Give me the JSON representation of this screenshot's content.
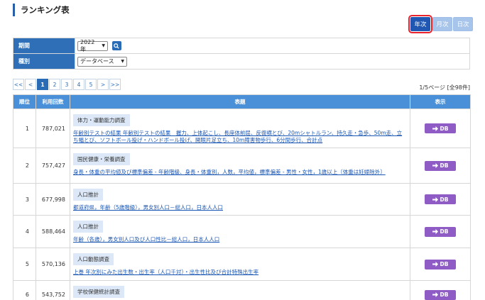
{
  "page_title": "ランキング表",
  "period_tabs": [
    "年次",
    "月次",
    "日次"
  ],
  "filters": {
    "period_label": "期間",
    "period_value": "2022年",
    "type_label": "種別",
    "type_value": "データベース"
  },
  "pager": {
    "items": [
      "<<",
      "<",
      "1",
      "2",
      "3",
      "4",
      "5",
      ">",
      ">>"
    ],
    "info": "1/5ページ [全98件]"
  },
  "table": {
    "headers": [
      "順位",
      "利用回数",
      "表題",
      "表示"
    ],
    "db_label": "DB",
    "rows": [
      {
        "rank": "1",
        "count": "787,021",
        "tag": "体力・運動能力調査",
        "link": "年齢別テストの結果 年齢別テストの結果　握力、上体起こし、長座体前屈、反復横とび、20mシャトルラン、持久走・急歩、50m走、立ち幅とび、ソフトボール投げ・ハンドボール投げ、開眼片足立ち、10m障害物歩行、6分間歩行、合計点"
      },
      {
        "rank": "2",
        "count": "757,427",
        "tag": "国民健康・栄養調査",
        "link": "身長・体重の平均値及び標準偏差 - 年齢階級、身長・体重別，人数，平均値，標準偏差 - 男性・女性，1歳以上〔体重は妊婦除外〕"
      },
      {
        "rank": "3",
        "count": "677,998",
        "tag": "人口推計",
        "link": "都道府県，年齢（5歳階級），男女別人口－総人口，日本人人口"
      },
      {
        "rank": "4",
        "count": "588,464",
        "tag": "人口推計",
        "link": "年齢（各歳），男女別人口及び人口性比－総人口，日本人人口"
      },
      {
        "rank": "5",
        "count": "570,136",
        "tag": "人口動態調査",
        "link": "上巻 年次別にみた出生数・出生率（人口千対）・出生性比及び合計特殊出生率"
      },
      {
        "rank": "6",
        "count": "543,752",
        "tag": "学校保健統計調査",
        "link": ""
      }
    ]
  },
  "colors": {
    "accent": "#2a6bb5",
    "header": "#4a90d9",
    "db_button": "#8e5cc4",
    "highlight": "#e8212b"
  }
}
